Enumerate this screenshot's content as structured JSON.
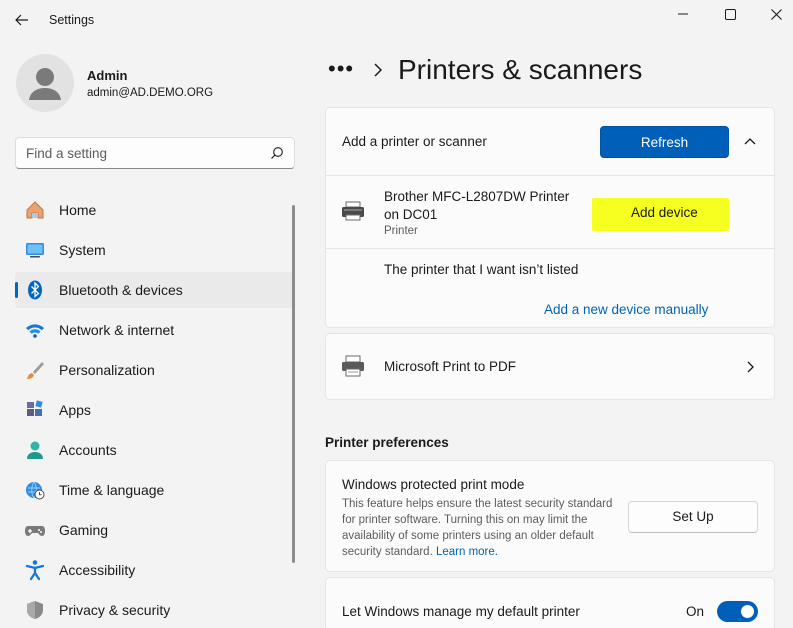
{
  "window": {
    "title": "Settings",
    "controls": {
      "minimize": "minimize-icon",
      "maximize": "maximize-icon",
      "close": "close-icon"
    }
  },
  "profile": {
    "name": "Admin",
    "email": "admin@AD.DEMO.ORG"
  },
  "search": {
    "placeholder": "Find a setting"
  },
  "nav": {
    "items": [
      {
        "label": "Home",
        "icon": "home-icon"
      },
      {
        "label": "System",
        "icon": "system-icon"
      },
      {
        "label": "Bluetooth & devices",
        "icon": "bluetooth-icon",
        "active": true
      },
      {
        "label": "Network & internet",
        "icon": "wifi-icon"
      },
      {
        "label": "Personalization",
        "icon": "brush-icon"
      },
      {
        "label": "Apps",
        "icon": "apps-icon"
      },
      {
        "label": "Accounts",
        "icon": "accounts-icon"
      },
      {
        "label": "Time & language",
        "icon": "globe-clock-icon"
      },
      {
        "label": "Gaming",
        "icon": "gamepad-icon"
      },
      {
        "label": "Accessibility",
        "icon": "accessibility-icon"
      },
      {
        "label": "Privacy & security",
        "icon": "shield-icon"
      }
    ]
  },
  "header": {
    "breadcrumb_more": "•••",
    "title": "Printers & scanners"
  },
  "add_printer": {
    "label": "Add a printer or scanner",
    "refresh_label": "Refresh",
    "device": {
      "name_line1": "Brother MFC-L2807DW Printer",
      "name_line2": "on DC01",
      "type": "Printer",
      "add_label": "Add device"
    },
    "not_listed": "The printer that I want isn’t listed",
    "manual_link": "Add a new device manually"
  },
  "printers": [
    {
      "name": "Microsoft Print to PDF"
    }
  ],
  "preferences": {
    "title": "Printer preferences",
    "protected_mode": {
      "title": "Windows protected print mode",
      "description": "This feature helps ensure the latest security standard for printer software. Turning this on may limit the availability of some printers using an older default security standard.",
      "learn_more": "Learn more.",
      "button": "Set Up"
    },
    "default_printer": {
      "label": "Let Windows manage my default printer",
      "state": "On"
    }
  },
  "colors": {
    "accent": "#005fb8",
    "highlight": "#f5ff20",
    "link": "#0063b1"
  }
}
